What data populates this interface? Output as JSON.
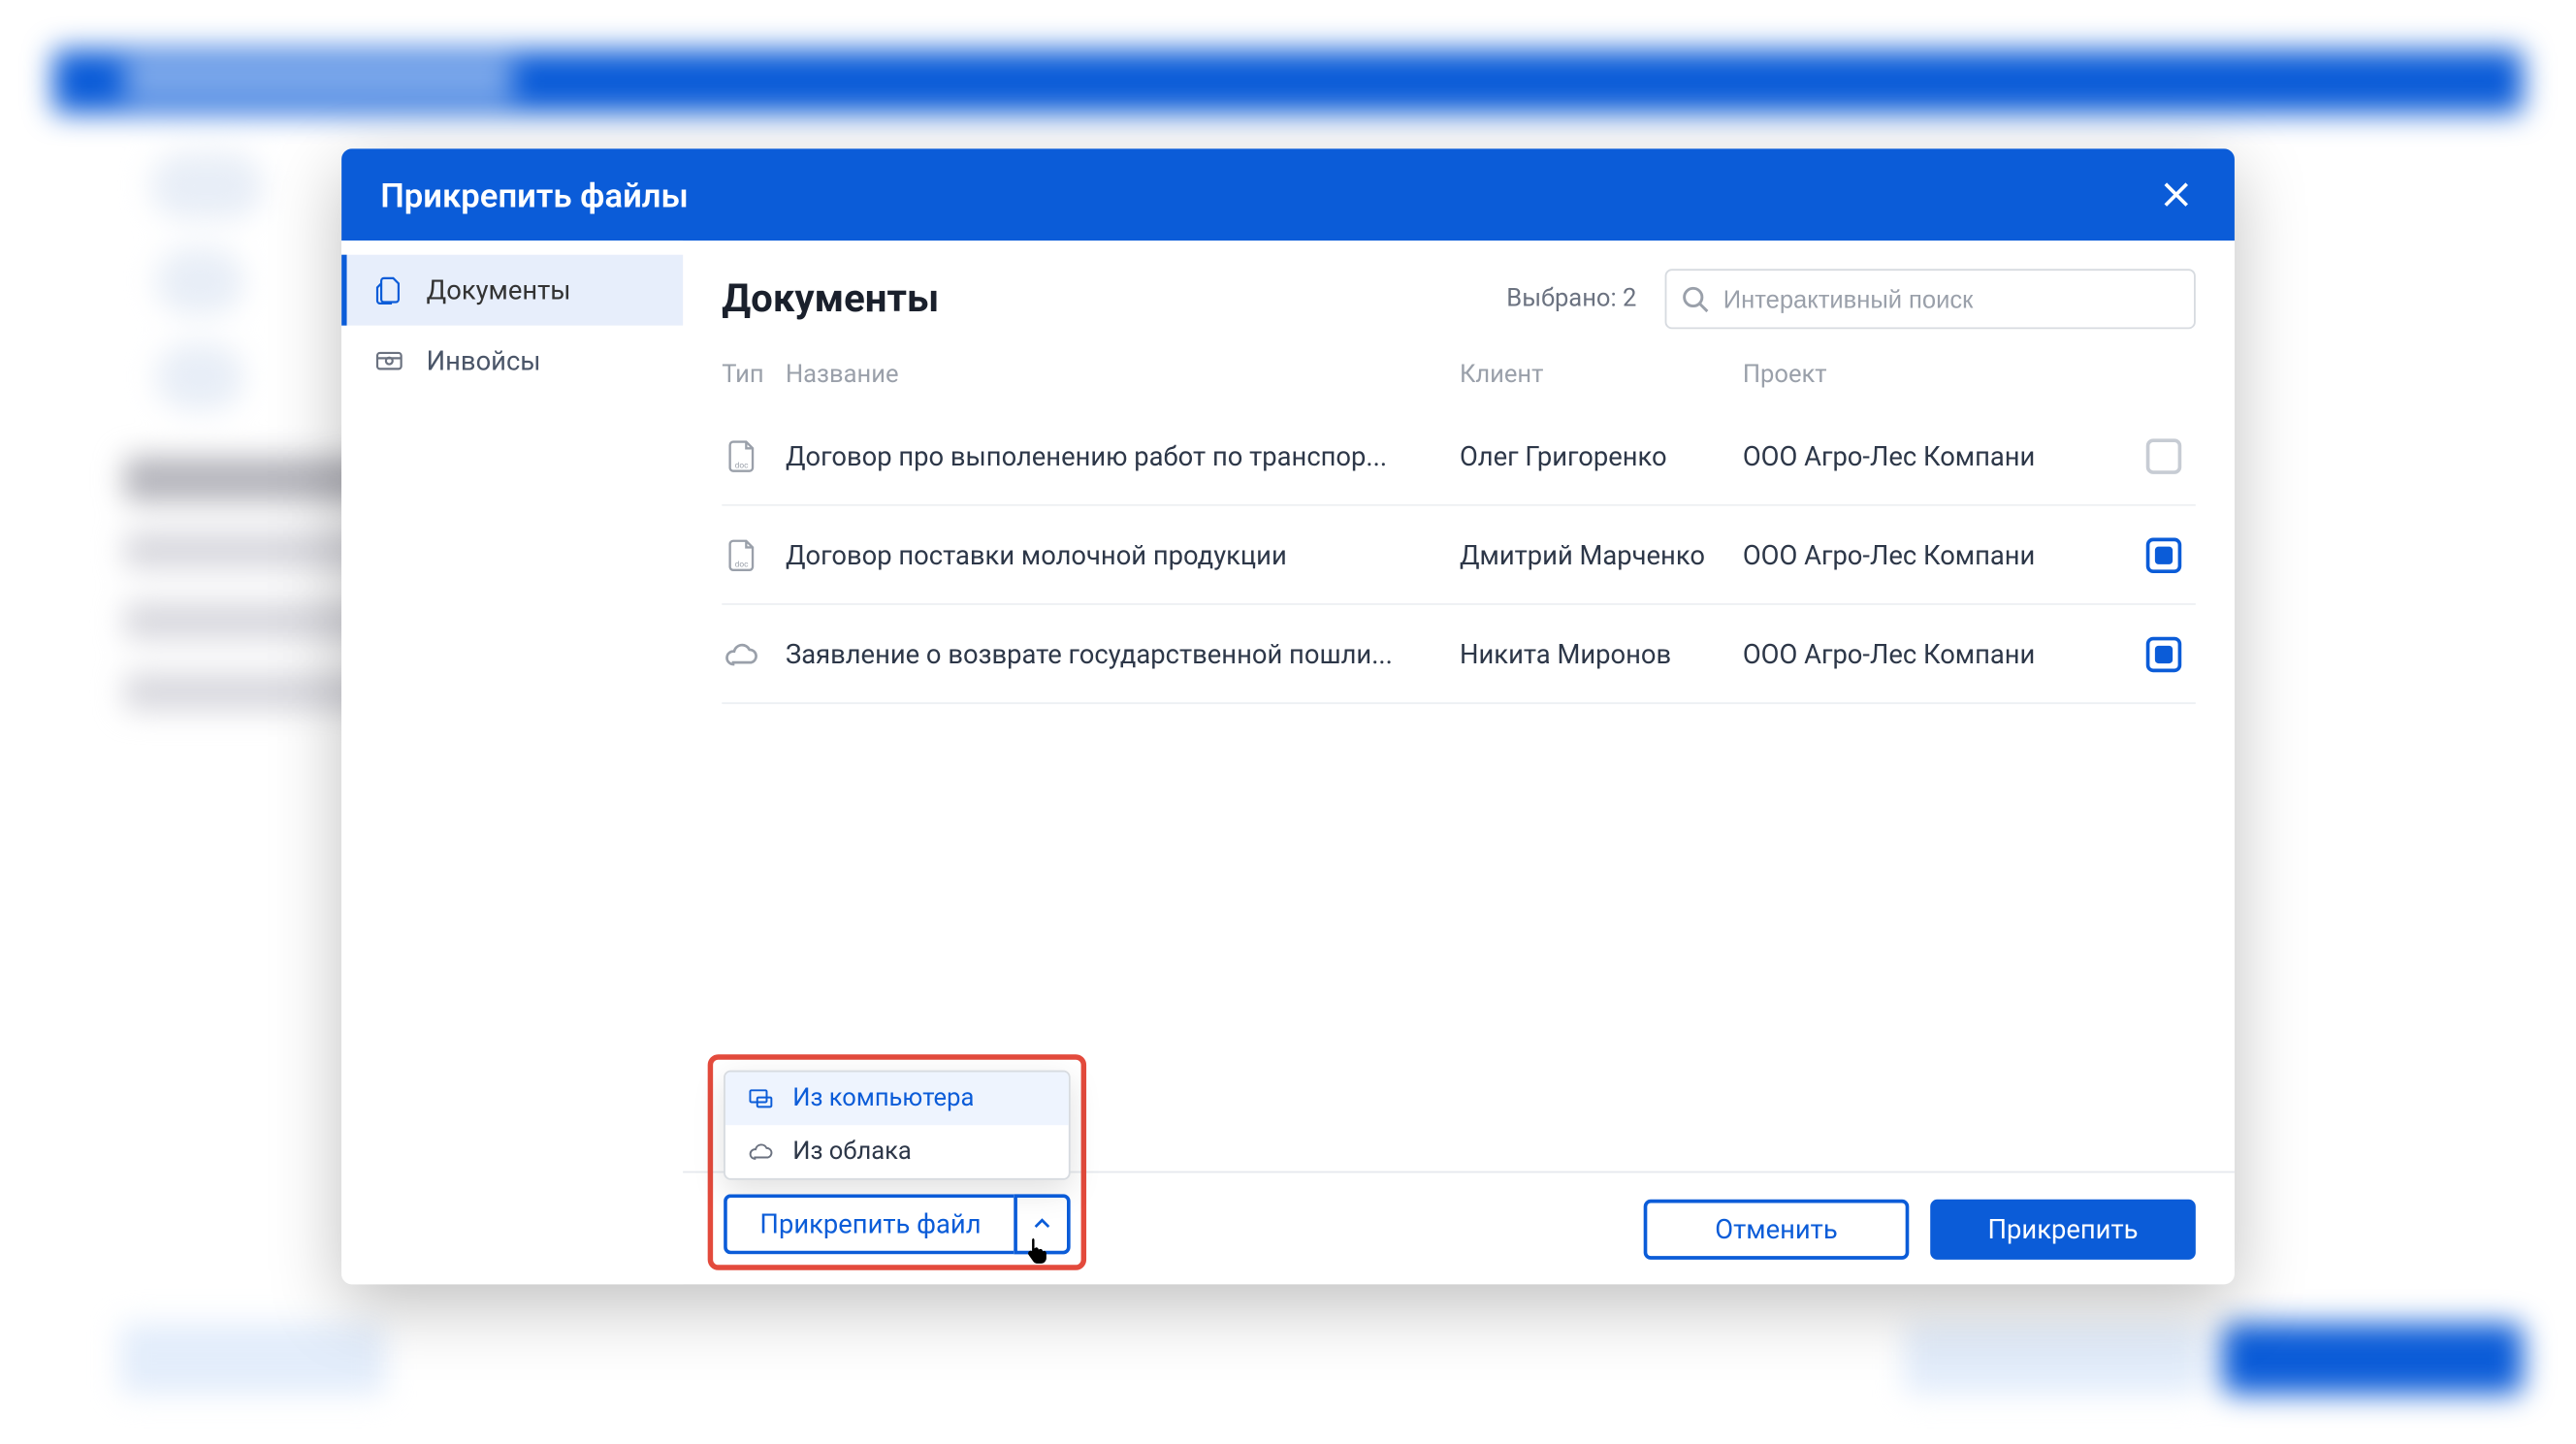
{
  "modal": {
    "title": "Прикрепить файлы"
  },
  "sidebar": {
    "items": [
      {
        "label": "Документы"
      },
      {
        "label": "Инвойсы"
      }
    ]
  },
  "main": {
    "title": "Документы",
    "selected_label": "Выбрано: 2"
  },
  "search": {
    "placeholder": "Интерактивный поиск"
  },
  "table": {
    "headers": {
      "type": "Тип",
      "name": "Название",
      "client": "Клиент",
      "project": "Проект"
    },
    "rows": [
      {
        "icon": "doc",
        "name": "Договор про выполенению работ по транспор...",
        "client": "Олег Григоренко",
        "project": "ООО Агро-Лес Компани",
        "checked": false
      },
      {
        "icon": "doc",
        "name": "Договор поставки молочной продукции",
        "client": "Дмитрий Марченко",
        "project": "ООО Агро-Лес Компани",
        "checked": true
      },
      {
        "icon": "cloud",
        "name": "Заявление о возврате государственной пошли...",
        "client": "Никита Миронов",
        "project": "ООО Агро-Лес Компани",
        "checked": true
      }
    ]
  },
  "attach_menu": {
    "from_computer": "Из компьютера",
    "from_cloud": "Из облака",
    "button": "Прикрепить файл"
  },
  "footer": {
    "cancel": "Отменить",
    "attach": "Прикрепить"
  }
}
